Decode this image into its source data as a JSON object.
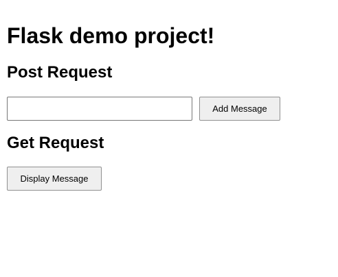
{
  "header": {
    "title": "Flask demo project!"
  },
  "post_section": {
    "title": "Post Request",
    "input_value": "",
    "input_placeholder": "",
    "button_label": "Add Message"
  },
  "get_section": {
    "title": "Get Request",
    "button_label": "Display Message"
  }
}
